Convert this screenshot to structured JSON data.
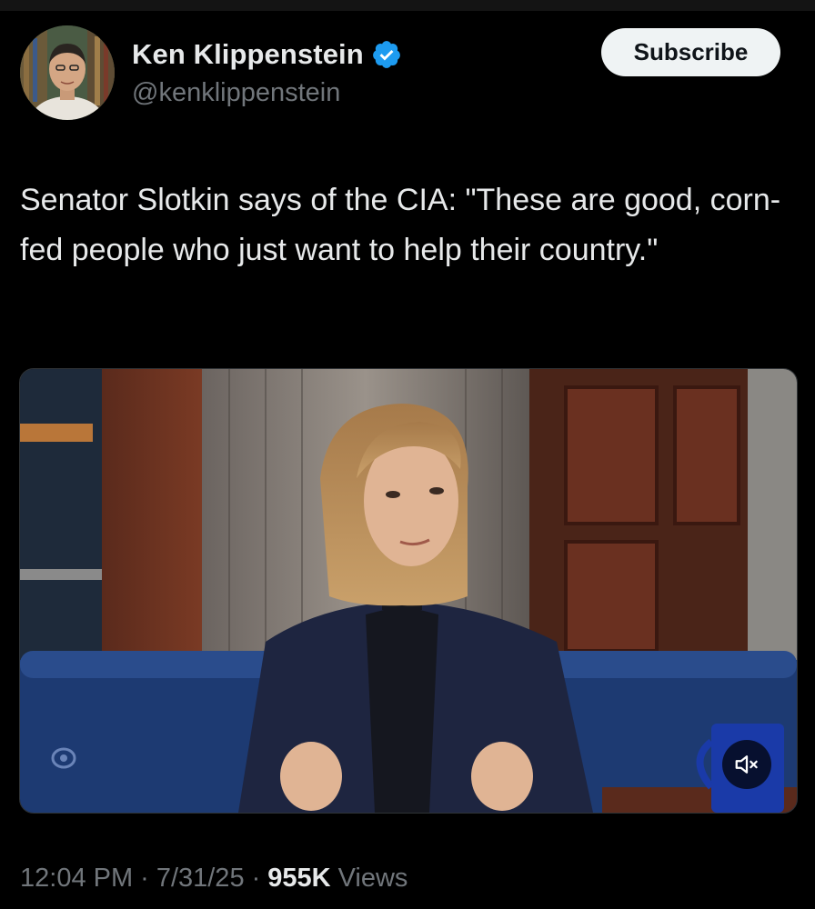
{
  "author": {
    "name": "Ken Klippenstein",
    "handle": "@kenklippenstein",
    "verified": true,
    "verified_color": "#1d9bf0"
  },
  "actions": {
    "subscribe_label": "Subscribe"
  },
  "tweet": {
    "text": "Senator Slotkin says of the CIA: \"These are good, corn-fed people who just want to help their country.\""
  },
  "media": {
    "type": "video",
    "muted": true,
    "icons": [
      "mute-icon",
      "cbs-logo-icon"
    ]
  },
  "meta": {
    "time": "12:04 PM",
    "separator": "·",
    "date": "7/31/25",
    "views_count": "955K",
    "views_label": "Views"
  },
  "colors": {
    "background": "#000000",
    "text_primary": "#e7e9ea",
    "text_secondary": "#71767b",
    "button_bg": "#eff3f4"
  }
}
